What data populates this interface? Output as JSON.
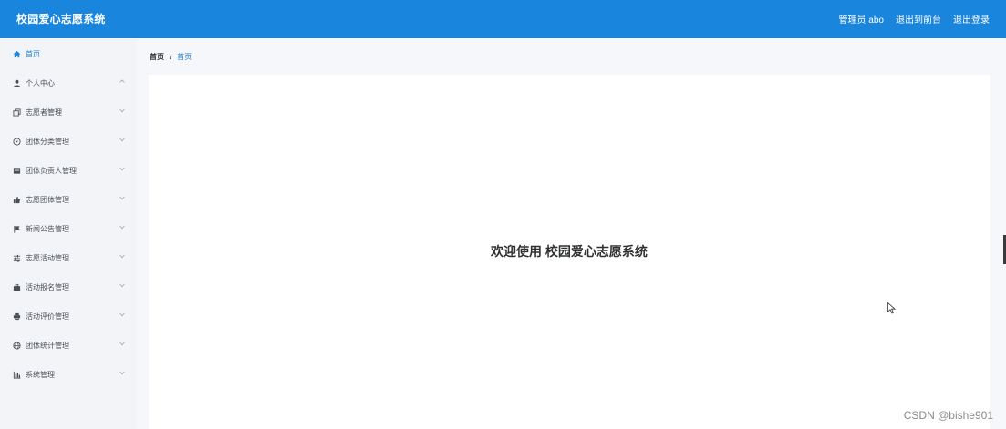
{
  "header": {
    "title": "校园爱心志愿系统",
    "user_label": "管理员 abo",
    "frontend_link": "退出到前台",
    "logout_link": "退出登录"
  },
  "sidebar": {
    "items": [
      {
        "label": "首页",
        "icon": "home-icon",
        "active": true,
        "has_arrow": false
      },
      {
        "label": "个人中心",
        "icon": "user-icon",
        "active": false,
        "has_arrow": true,
        "arrow": "up"
      },
      {
        "label": "志愿者管理",
        "icon": "copy-icon",
        "active": false,
        "has_arrow": true,
        "arrow": "down"
      },
      {
        "label": "团体分类管理",
        "icon": "compass-icon",
        "active": false,
        "has_arrow": true,
        "arrow": "down"
      },
      {
        "label": "团体负责人管理",
        "icon": "card-icon",
        "active": false,
        "has_arrow": true,
        "arrow": "down"
      },
      {
        "label": "志愿团体管理",
        "icon": "thumb-icon",
        "active": false,
        "has_arrow": true,
        "arrow": "down"
      },
      {
        "label": "新闻公告管理",
        "icon": "flag-icon",
        "active": false,
        "has_arrow": true,
        "arrow": "down"
      },
      {
        "label": "志愿活动管理",
        "icon": "sliders-icon",
        "active": false,
        "has_arrow": true,
        "arrow": "down"
      },
      {
        "label": "活动报名管理",
        "icon": "briefcase-icon",
        "active": false,
        "has_arrow": true,
        "arrow": "down"
      },
      {
        "label": "活动评价管理",
        "icon": "printer-icon",
        "active": false,
        "has_arrow": true,
        "arrow": "down"
      },
      {
        "label": "团体统计管理",
        "icon": "globe-icon",
        "active": false,
        "has_arrow": true,
        "arrow": "down"
      },
      {
        "label": "系统管理",
        "icon": "chart-icon",
        "active": false,
        "has_arrow": true,
        "arrow": "down"
      }
    ]
  },
  "breadcrumb": {
    "root": "首页",
    "separator": "/",
    "current": "首页"
  },
  "main": {
    "welcome": "欢迎使用 校园爱心志愿系统"
  },
  "watermark": "CSDN @bishe901",
  "colors": {
    "primary": "#1a85dd",
    "sidebar_bg": "#f2f4f7",
    "content_bg": "#f5f7fa"
  }
}
